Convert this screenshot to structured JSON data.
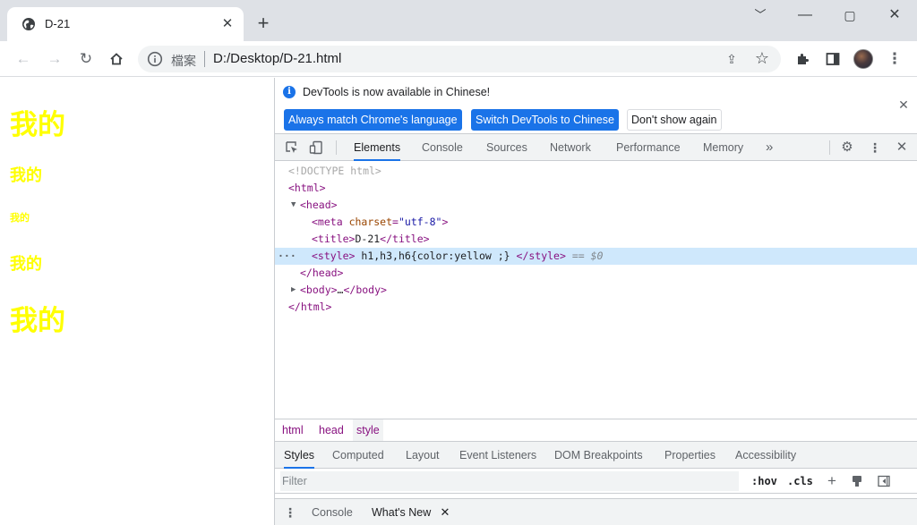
{
  "browser": {
    "tab": {
      "title": "D-21"
    },
    "address": {
      "security_label": "檔案",
      "url": "D:/Desktop/D-21.html"
    }
  },
  "page": {
    "headings": [
      {
        "level": "h1",
        "text": "我的"
      },
      {
        "level": "h3",
        "text": "我的"
      },
      {
        "level": "h6",
        "text": "我的"
      },
      {
        "level": "h3",
        "text": "我的"
      },
      {
        "level": "h1",
        "text": "我的"
      }
    ],
    "heading_color": "#ffff00"
  },
  "devtools": {
    "infobar": {
      "message": "DevTools is now available in Chinese!",
      "buttons": [
        "Always match Chrome's language",
        "Switch DevTools to Chinese",
        "Don't show again"
      ]
    },
    "panels": [
      "Elements",
      "Console",
      "Sources",
      "Network",
      "Performance",
      "Memory"
    ],
    "active_panel": "Elements",
    "more_panels_glyph": "»",
    "dom": {
      "doctype": "<!DOCTYPE html>",
      "html_open": "<html>",
      "head_open": "<head>",
      "meta_tag_start": "<meta",
      "meta_attr": "charset",
      "meta_eq": "=",
      "meta_val": "\"utf-8\"",
      "meta_tag_end": ">",
      "title_open": "<title>",
      "title_text": "D-21",
      "title_close": "</title>",
      "style_open": "<style>",
      "style_text": "h1,h3,h6{color:yellow ;}",
      "style_close": "</style>",
      "selected_marker": "== $0",
      "head_close": "</head>",
      "body_open": "<body>",
      "body_ellipsis": "…",
      "body_close": "</body>",
      "html_close": "</html>"
    },
    "breadcrumbs": [
      "html",
      "head",
      "style"
    ],
    "active_breadcrumb": "style",
    "subpanels": [
      "Styles",
      "Computed",
      "Layout",
      "Event Listeners",
      "DOM Breakpoints",
      "Properties",
      "Accessibility"
    ],
    "active_subpanel": "Styles",
    "filter": {
      "placeholder": "Filter",
      "hov": ":hov",
      "cls": ".cls"
    },
    "drawer": {
      "tabs": [
        "Console",
        "What's New"
      ],
      "active": "What's New"
    }
  },
  "colors": {
    "accent": "#1a73e8",
    "selection": "#cfe8fc",
    "tag": "#881280",
    "attr": "#994500",
    "value": "#1a1aa6"
  },
  "icons": [
    "globe-icon",
    "close-icon",
    "plus-icon",
    "chevron-down-icon",
    "minimize-icon",
    "maximize-icon",
    "back-icon",
    "forward-icon",
    "reload-icon",
    "home-icon",
    "info-icon",
    "share-icon",
    "star-icon",
    "extensions-icon",
    "sidepanel-icon",
    "profile-avatar",
    "more-vert-icon",
    "inspect-icon",
    "device-toolbar-icon",
    "gear-icon",
    "new-style-rule-icon",
    "element-state-icon",
    "toggle-sidebar-icon"
  ]
}
